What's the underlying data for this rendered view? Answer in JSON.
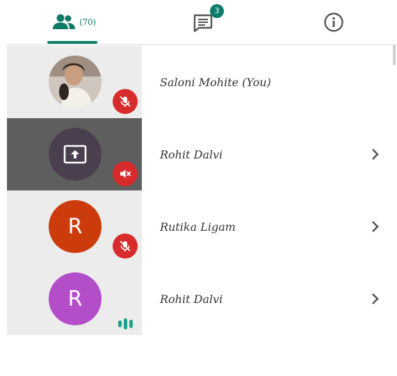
{
  "tabs": {
    "people": {
      "icon": "people-icon",
      "count": "(70)"
    },
    "chat": {
      "icon": "chat-icon",
      "badge": "3"
    },
    "info": {
      "icon": "info-icon"
    }
  },
  "participants": [
    {
      "name": "Saloni Mohite (You)",
      "avatar": "photo",
      "status": "mic-off-icon"
    },
    {
      "name": "Rohit Dalvi",
      "avatar": "screen-share-icon",
      "status": "speaker-off-icon"
    },
    {
      "name": "Rutika Ligam",
      "avatar_letter": "R",
      "status": "mic-off-icon"
    },
    {
      "name": "Rohit Dalvi",
      "avatar_letter": "R",
      "status": "speaking-icon"
    }
  ],
  "colors": {
    "accent": "#0c7b67",
    "muted_red": "#d82b2b",
    "avatar_orange": "#cc3b0c",
    "avatar_purple": "#b34ec8",
    "screen_share_bg": "#5e5e5e"
  }
}
